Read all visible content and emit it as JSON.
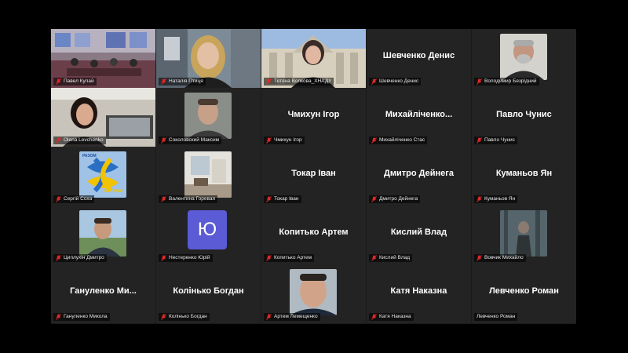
{
  "participants": [
    {
      "label": "Павел Кулай",
      "display": "",
      "type": "video",
      "scene": "classroom",
      "muted": true
    },
    {
      "label": "Наталія Птиця",
      "display": "",
      "type": "video",
      "scene": "woman-blonde",
      "muted": true
    },
    {
      "label": "Тетяна Волкова_ХНАДУ",
      "display": "",
      "type": "video",
      "scene": "woman-building",
      "muted": true
    },
    {
      "label": "Шевченко Денис",
      "display": "Шевченко Денис",
      "type": "name",
      "muted": true
    },
    {
      "label": "Володимир Безрідний",
      "display": "",
      "type": "avatar",
      "scene": "man-grey",
      "muted": true
    },
    {
      "label": "Olena Levchenko",
      "display": "",
      "type": "video",
      "scene": "woman-office",
      "muted": true,
      "active": true
    },
    {
      "label": "Соколовский Максим",
      "display": "",
      "type": "avatar",
      "scene": "man-young",
      "muted": true
    },
    {
      "label": "Чмихун Ігор",
      "display": "Чмихун Ігор",
      "type": "name",
      "muted": true
    },
    {
      "label": "Михайліченко Стас",
      "display": "Михайліченко...",
      "type": "name",
      "muted": true
    },
    {
      "label": "Павло Чунис",
      "display": "Павло Чунис",
      "type": "name",
      "muted": true
    },
    {
      "label": "Сергій Соха",
      "display": "",
      "type": "avatar",
      "scene": "knot",
      "muted": true,
      "thumb_text": [
        "РАЗОМ",
        "МИ СИЛА!"
      ]
    },
    {
      "label": "Валентина Горевая",
      "display": "",
      "type": "avatar",
      "scene": "room",
      "muted": true
    },
    {
      "label": "Токар Іван",
      "display": "Токар Іван",
      "type": "name",
      "muted": true
    },
    {
      "label": "Дмитро Дейнега",
      "display": "Дмитро Дейнега",
      "type": "name",
      "muted": true
    },
    {
      "label": "Куманьов Ян",
      "display": "Куманьов Ян",
      "type": "name",
      "muted": true
    },
    {
      "label": "Циплухін Дмитро",
      "display": "",
      "type": "avatar",
      "scene": "man-outdoor",
      "muted": true
    },
    {
      "label": "Нестеренко Юрій",
      "display": "",
      "type": "initial",
      "initial": "Ю",
      "muted": true
    },
    {
      "label": "Копитько Артем",
      "display": "Копитько Артем",
      "type": "name",
      "muted": true
    },
    {
      "label": "Кислий Влад",
      "display": "Кислий Влад",
      "type": "name",
      "muted": true
    },
    {
      "label": "Вовчик Михайло",
      "display": "",
      "type": "avatar",
      "scene": "forest",
      "muted": true
    },
    {
      "label": "Гануленко Микола",
      "display": "Гануленко Ми...",
      "type": "name",
      "muted": true
    },
    {
      "label": "Колінько Богдан",
      "display": "Колінько Богдан",
      "type": "name",
      "muted": true
    },
    {
      "label": "Артем Лемещенко",
      "display": "",
      "type": "avatar",
      "scene": "man-face",
      "muted": true
    },
    {
      "label": "Катя Наказна",
      "display": "Катя Наказна",
      "type": "name",
      "muted": true
    },
    {
      "label": "Левченко Роман",
      "display": "Левченко Роман",
      "type": "name",
      "muted": false
    }
  ],
  "colors": {
    "tile_bg": "#232323",
    "stage_bg": "#1a1a1a",
    "active_border": "#3cb043",
    "mute_red": "#e02828",
    "initial_bg": "#5b5bd6"
  }
}
